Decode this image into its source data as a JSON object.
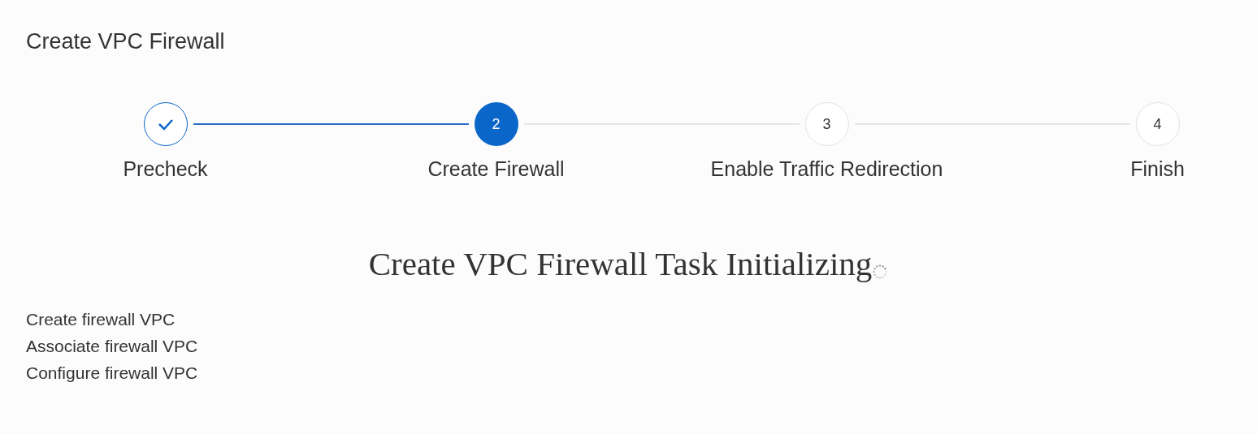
{
  "title": "Create VPC Firewall",
  "steps": [
    {
      "label": "Precheck",
      "done": true,
      "selected": false
    },
    {
      "number": "2",
      "label": "Create Firewall",
      "done": false,
      "selected": true
    },
    {
      "number": "3",
      "label": "Enable Traffic Redirection",
      "done": false,
      "selected": false
    },
    {
      "number": "4",
      "label": "Finish",
      "done": false,
      "selected": false
    }
  ],
  "task_heading": "Create VPC Firewall Task Initializing",
  "task_loading": true,
  "task_items": [
    "Create firewall VPC",
    "Associate firewall VPC",
    "Configure firewall VPC"
  ]
}
